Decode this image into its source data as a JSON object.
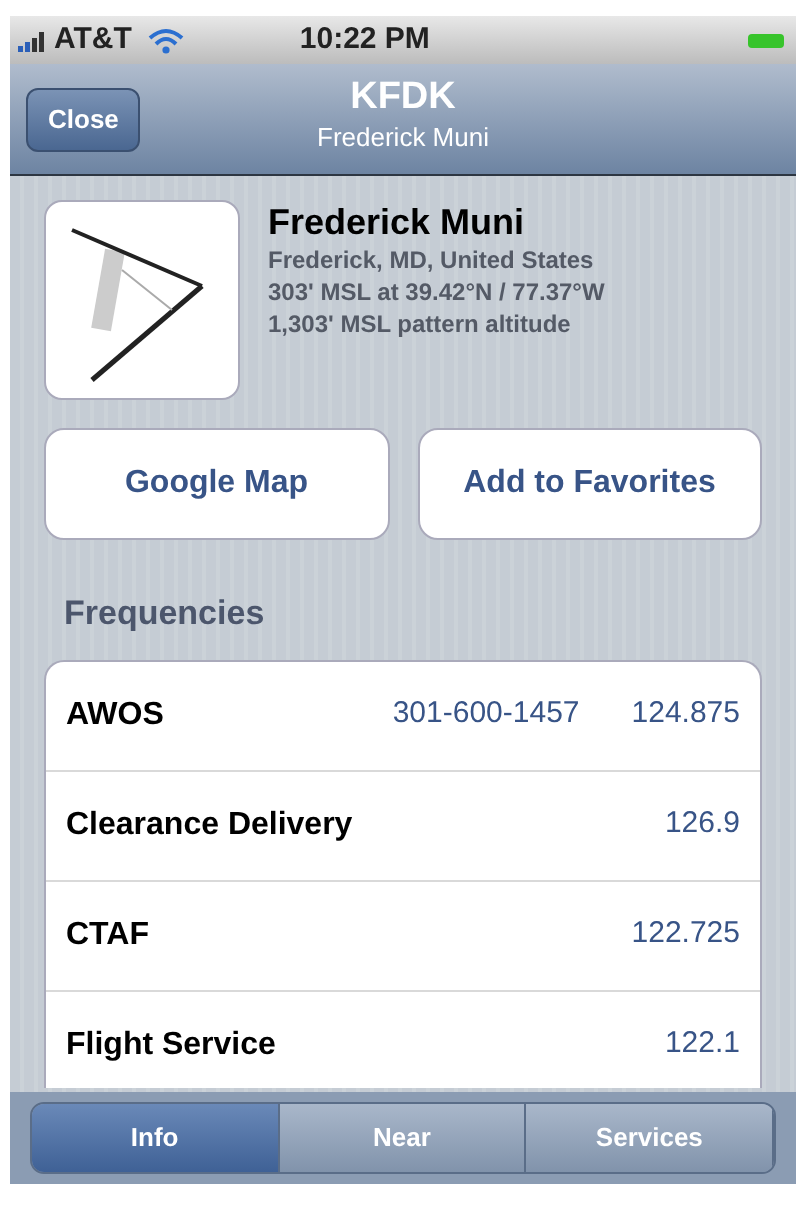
{
  "status_bar": {
    "carrier": "AT&T",
    "time": "10:22 PM"
  },
  "nav_bar": {
    "back_button": "Close",
    "title": "KFDK",
    "subtitle": "Frederick Muni"
  },
  "airport": {
    "name": "Frederick Muni",
    "location": "Frederick, MD, United States",
    "elevation": "303' MSL at 39.42°N / 77.37°W",
    "pattern": "1,303' MSL pattern altitude"
  },
  "buttons": [
    "Google Map",
    "Add to Favorites"
  ],
  "section_title": "Frequencies",
  "frequencies": [
    {
      "name": "AWOS",
      "phone": "301-600-1457",
      "frequency": "124.875"
    },
    {
      "name": "Clearance Delivery",
      "frequency": "126.9"
    },
    {
      "name": "CTAF",
      "frequency": "122.725"
    },
    {
      "name": "Flight Service",
      "frequency": "122.1"
    }
  ],
  "tabs": [
    {
      "label": "Info",
      "selected": true
    },
    {
      "label": "Near",
      "selected": false
    },
    {
      "label": "Services",
      "selected": false
    }
  ]
}
